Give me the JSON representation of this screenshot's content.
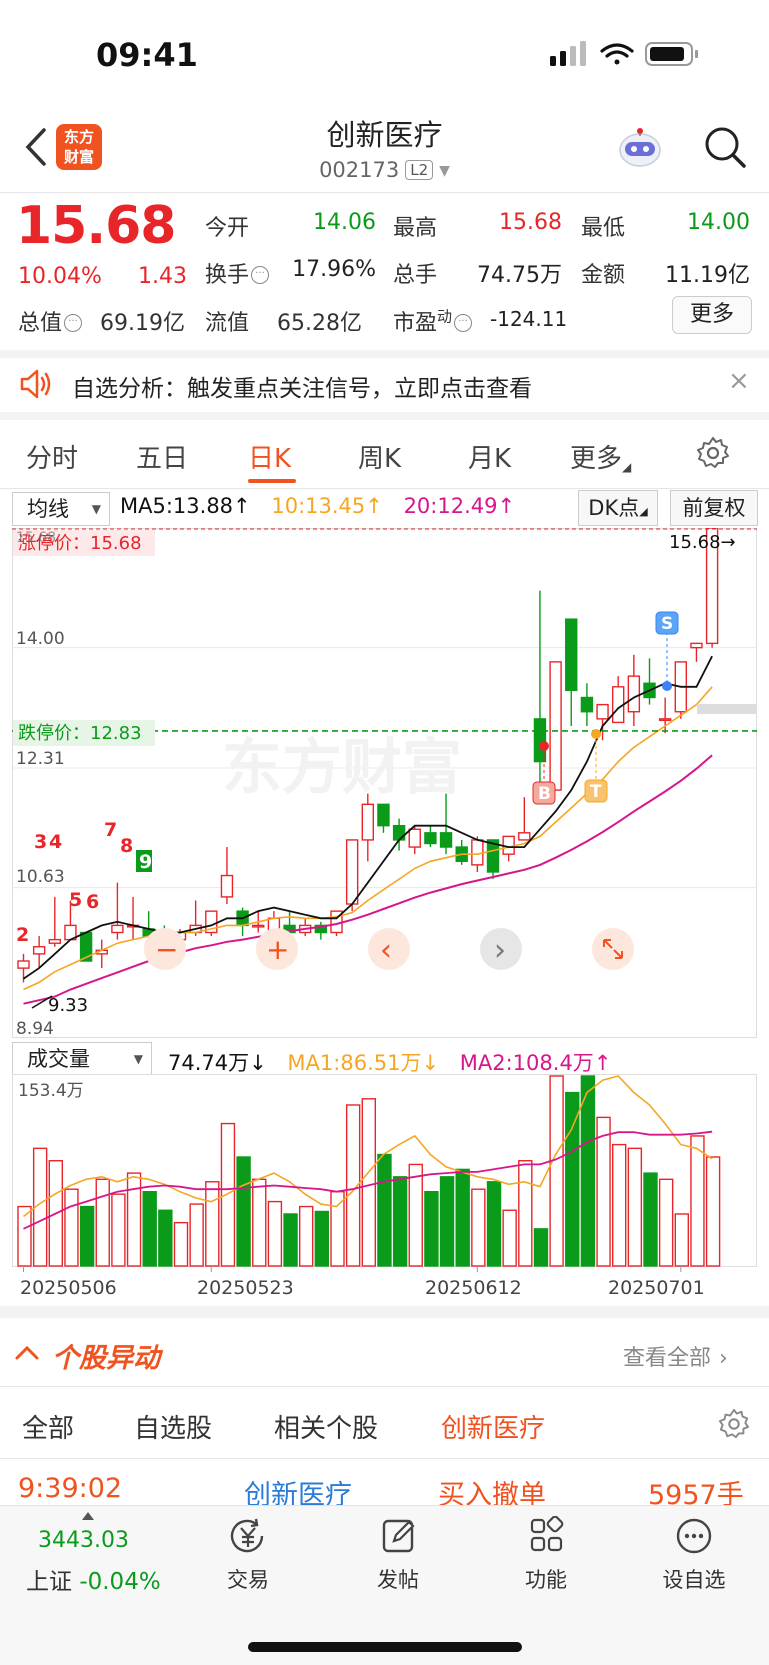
{
  "status": {
    "time": "09:41"
  },
  "header": {
    "logo_line1": "东方",
    "logo_line2": "财富",
    "name": "创新医疗",
    "code": "002173",
    "level": "L2"
  },
  "quote": {
    "price": "15.68",
    "pct": "10.04%",
    "change": "1.43",
    "open_label": "今开",
    "open": "14.06",
    "high_label": "最高",
    "high": "15.68",
    "low_label": "最低",
    "low": "14.00",
    "turnover_label": "换手",
    "turnover": "17.96%",
    "volume_label": "总手",
    "volume": "74.75万",
    "amount_label": "金额",
    "amount": "11.19亿",
    "mktcap_label": "总值",
    "mktcap": "69.19亿",
    "float_label": "流值",
    "float": "65.28亿",
    "pe_label": "市盈",
    "pe_sup": "动",
    "pe": "-124.11",
    "more": "更多"
  },
  "banner": {
    "text": "自选分析：触发重点关注信号，立即点击查看",
    "close": "×"
  },
  "tabs": [
    {
      "label": "分时"
    },
    {
      "label": "五日"
    },
    {
      "label": "日K"
    },
    {
      "label": "周K"
    },
    {
      "label": "月K"
    },
    {
      "label": "更多"
    }
  ],
  "chart_toolbar": {
    "indicator": "均线",
    "ma5": "MA5:13.88",
    "ma10": "10:13.45",
    "ma20": "20:12.49",
    "dk": "DK点",
    "adjust": "前复权"
  },
  "chart_labels": {
    "limit_up": "涨停价：15.68",
    "limit_down": "跌停价：12.83",
    "y_1568": "15.68",
    "y_1400": "14.00",
    "y_1231": "12.31",
    "y_1063": "10.63",
    "y_894": "8.94",
    "latest_tag": "15.68→",
    "low_tag": "9.33",
    "top_partial": "15.68",
    "signal_b": "B",
    "signal_s": "S",
    "signal_t": "T",
    "n2": "2",
    "n3": "3",
    "n4": "4",
    "n5": "5",
    "n6": "6",
    "n7": "7",
    "n8": "8",
    "n9": "9"
  },
  "chart_controls": {
    "zoom_out": "−",
    "zoom_in": "+",
    "prev": "‹",
    "next": "›"
  },
  "vol_toolbar": {
    "indicator": "成交量",
    "vol": "74.74万",
    "ma1": "MA1:86.51万",
    "ma2": "MA2:108.4万",
    "vmax": "153.4万"
  },
  "x_dates": [
    "20250506",
    "20250523",
    "20250612",
    "20250701"
  ],
  "section": {
    "title": "个股异动",
    "view_all": "查看全部"
  },
  "sub_tabs": [
    {
      "label": "全部"
    },
    {
      "label": "自选股"
    },
    {
      "label": "相关个股"
    },
    {
      "label": "创新医疗"
    }
  ],
  "event": {
    "time": "9:39:02",
    "name": "创新医疗",
    "type": "买入撤单",
    "qty": "5957手"
  },
  "bottom": {
    "index_value": "3443.03",
    "index_name": "上证",
    "index_change": "-0.04%",
    "trade": "交易",
    "post": "发帖",
    "func": "功能",
    "watch": "设自选"
  },
  "colors": {
    "up": "#e8262a",
    "down": "#0b9b1b",
    "ma5": "#111111",
    "ma10": "#f5a623",
    "ma20": "#d6168b",
    "accent": "#f0531f"
  },
  "chart_data": {
    "type": "candlestick",
    "y_range": [
      8.94,
      15.68
    ],
    "candles": [
      [
        9.5,
        9.7,
        9.3,
        9.6
      ],
      [
        9.7,
        9.95,
        9.5,
        9.8
      ],
      [
        9.85,
        10.5,
        9.8,
        9.9
      ],
      [
        9.9,
        10.45,
        9.95,
        10.1
      ],
      [
        10.0,
        10.0,
        9.6,
        9.6
      ],
      [
        9.7,
        9.9,
        9.5,
        9.75
      ],
      [
        10.0,
        10.7,
        9.9,
        10.1
      ],
      [
        10.1,
        10.5,
        9.9,
        10.1
      ],
      [
        10.05,
        10.3,
        9.8,
        9.95
      ],
      [
        9.9,
        10.1,
        9.75,
        9.85
      ],
      [
        9.9,
        10.05,
        9.8,
        10.0
      ],
      [
        10.0,
        10.45,
        9.95,
        10.1
      ],
      [
        10.0,
        10.3,
        9.95,
        10.3
      ],
      [
        10.5,
        11.2,
        10.4,
        10.8
      ],
      [
        10.3,
        10.35,
        9.95,
        10.1
      ],
      [
        10.1,
        10.3,
        10.0,
        10.1
      ],
      [
        10.0,
        10.3,
        9.95,
        10.2
      ],
      [
        10.1,
        10.3,
        10.0,
        10.0
      ],
      [
        10.0,
        10.2,
        9.95,
        10.1
      ],
      [
        10.1,
        10.15,
        9.9,
        10.0
      ],
      [
        10.0,
        10.3,
        9.95,
        10.3
      ],
      [
        10.4,
        11.3,
        10.3,
        11.3
      ],
      [
        11.3,
        11.95,
        11.0,
        11.8
      ],
      [
        11.8,
        11.6,
        11.4,
        11.5
      ],
      [
        11.5,
        11.6,
        11.15,
        11.3
      ],
      [
        11.2,
        11.5,
        11.1,
        11.45
      ],
      [
        11.4,
        11.5,
        11.2,
        11.25
      ],
      [
        11.4,
        11.95,
        11.1,
        11.2
      ],
      [
        11.2,
        11.3,
        10.95,
        11.0
      ],
      [
        10.95,
        11.35,
        10.85,
        11.3
      ],
      [
        11.3,
        11.2,
        10.75,
        10.85
      ],
      [
        11.1,
        11.2,
        11.0,
        11.35
      ],
      [
        11.3,
        11.9,
        11.3,
        11.4
      ],
      [
        13.0,
        14.8,
        12.0,
        12.4
      ],
      [
        12.0,
        13.8,
        12.0,
        13.8
      ],
      [
        14.4,
        14.3,
        12.9,
        13.4
      ],
      [
        13.3,
        13.5,
        12.9,
        13.1
      ],
      [
        13.0,
        13.2,
        12.7,
        13.2
      ],
      [
        12.95,
        13.6,
        12.95,
        13.45
      ],
      [
        13.1,
        13.9,
        12.9,
        13.6
      ],
      [
        13.5,
        13.85,
        13.2,
        13.3
      ],
      [
        13.0,
        13.3,
        12.8,
        13.0
      ],
      [
        13.1,
        13.8,
        13.0,
        13.8
      ],
      [
        14.0,
        14.0,
        13.8,
        14.06
      ],
      [
        14.06,
        15.68,
        14.0,
        15.68
      ]
    ],
    "ma5": [
      9.35,
      9.5,
      9.7,
      9.9,
      10.0,
      10.1,
      10.15,
      10.1,
      10.05,
      10.0,
      10.0,
      10.05,
      10.1,
      10.2,
      10.2,
      10.3,
      10.35,
      10.3,
      10.25,
      10.2,
      10.2,
      10.4,
      10.7,
      11.0,
      11.3,
      11.5,
      11.5,
      11.5,
      11.4,
      11.3,
      11.25,
      11.2,
      11.2,
      11.45,
      11.7,
      12.0,
      12.4,
      12.9,
      13.15,
      13.3,
      13.4,
      13.5,
      13.45,
      13.45,
      13.88
    ],
    "ma10": [
      9.2,
      9.3,
      9.45,
      9.55,
      9.65,
      9.75,
      9.85,
      9.9,
      9.95,
      10.0,
      10.0,
      10.0,
      10.05,
      10.1,
      10.1,
      10.15,
      10.2,
      10.22,
      10.2,
      10.2,
      10.22,
      10.28,
      10.45,
      10.6,
      10.75,
      10.9,
      11.0,
      11.05,
      11.1,
      11.1,
      11.15,
      11.2,
      11.25,
      11.35,
      11.55,
      11.75,
      11.95,
      12.15,
      12.4,
      12.6,
      12.75,
      12.9,
      13.05,
      13.2,
      13.45
    ],
    "ma20": [
      9.0,
      9.05,
      9.1,
      9.2,
      9.28,
      9.36,
      9.44,
      9.52,
      9.6,
      9.66,
      9.72,
      9.78,
      9.82,
      9.87,
      9.9,
      9.94,
      9.98,
      10.02,
      10.05,
      10.08,
      10.12,
      10.18,
      10.25,
      10.33,
      10.41,
      10.49,
      10.56,
      10.62,
      10.68,
      10.73,
      10.78,
      10.83,
      10.88,
      10.95,
      11.05,
      11.16,
      11.28,
      11.41,
      11.55,
      11.7,
      11.84,
      11.98,
      12.13,
      12.3,
      12.49
    ],
    "volumes": [
      48,
      95,
      85,
      62,
      48,
      70,
      58,
      75,
      60,
      45,
      35,
      50,
      68,
      115,
      88,
      70,
      52,
      42,
      48,
      44,
      60,
      130,
      135,
      90,
      72,
      82,
      60,
      72,
      78,
      62,
      68,
      45,
      85,
      30,
      210,
      140,
      215,
      120,
      98,
      95,
      75,
      70,
      42,
      105,
      88
    ],
    "vol_ma1": [
      40,
      50,
      58,
      65,
      70,
      72,
      68,
      72,
      70,
      66,
      60,
      55,
      52,
      58,
      65,
      70,
      75,
      68,
      58,
      50,
      48,
      60,
      75,
      90,
      98,
      105,
      90,
      80,
      76,
      72,
      70,
      66,
      68,
      64,
      90,
      110,
      140,
      150,
      155,
      140,
      130,
      115,
      98,
      95,
      86.51
    ],
    "vol_ma2": [
      30,
      36,
      42,
      48,
      52,
      56,
      60,
      62,
      64,
      65,
      64,
      62,
      62,
      62,
      63,
      64,
      65,
      64,
      63,
      62,
      60,
      62,
      65,
      68,
      70,
      72,
      74,
      75,
      76,
      76,
      78,
      80,
      82,
      82,
      86,
      92,
      100,
      105,
      108,
      108,
      106,
      106,
      106,
      107,
      108.4
    ],
    "vol_range": [
      0,
      153.4
    ]
  }
}
